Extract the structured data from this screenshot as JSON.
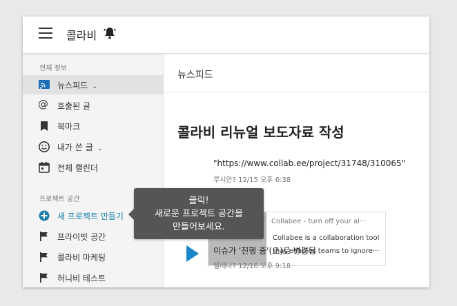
{
  "app": {
    "title": "콜라비"
  },
  "sidebar": {
    "section_all": "전체 정보",
    "items": [
      {
        "label": "뉴스피드",
        "icon": "feed-icon"
      },
      {
        "label": "호출된 글",
        "icon": "at-icon"
      },
      {
        "label": "북마크",
        "icon": "bookmark-icon"
      },
      {
        "label": "내가 쓴 글",
        "icon": "smiley-icon"
      },
      {
        "label": "전체 캘린더",
        "icon": "calendar-icon"
      }
    ],
    "section_projects": "프로젝트 공간",
    "new_project": "새 프로젝트 만들기",
    "projects": [
      {
        "label": "프라이빗 공간",
        "icon": "flag-icon"
      },
      {
        "label": "콜라비 마케팅",
        "icon": "flag-icon"
      },
      {
        "label": "허니비 테스트",
        "icon": "flag-icon"
      }
    ]
  },
  "main": {
    "header": "뉴스피드",
    "post_title": "콜라비 리뉴얼 보도자료 작성",
    "quote": "\"https://www.collab.ee/project/31748/310065\"",
    "quote_meta": "루시안? 12/15 오후 6:38",
    "card": {
      "title": "Collabee - turn off your al···",
      "desc_line1": "Collabee is a collaboration tool",
      "desc_line2": "that enables teams to ignore···"
    },
    "status": "이슈가 '진행 중'(으)로 변경됨",
    "status_meta": "헬레나? 12/16 오후 9:18"
  },
  "tooltip": {
    "line1": "클릭!",
    "line2": "새로운 프로젝트 공간을",
    "line3": "만들어보세요."
  },
  "colors": {
    "accent": "#1a7fa8",
    "play": "#1a86c8",
    "tooltip_bg": "#555555"
  }
}
